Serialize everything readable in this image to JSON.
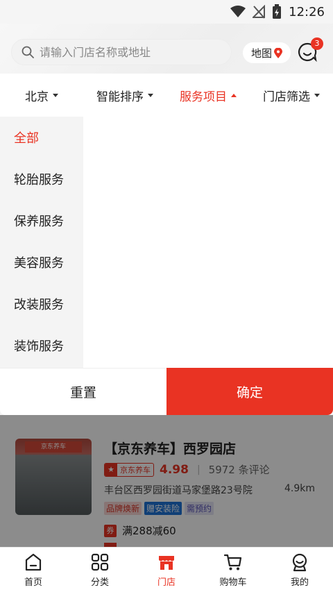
{
  "status_bar": {
    "time": "12:26"
  },
  "search": {
    "placeholder": "请输入门店名称或地址"
  },
  "header": {
    "map_label": "地图",
    "msg_badge": "3"
  },
  "filters": [
    {
      "label": "北京",
      "active": false
    },
    {
      "label": "智能排序",
      "active": false
    },
    {
      "label": "服务项目",
      "active": true
    },
    {
      "label": "门店筛选",
      "active": false
    }
  ],
  "categories": [
    "全部",
    "轮胎服务",
    "保养服务",
    "美容服务",
    "改装服务",
    "装饰服务"
  ],
  "dropdown": {
    "reset_label": "重置",
    "confirm_label": "确定"
  },
  "store": {
    "name": "【京东养车】西罗园店",
    "brand": "京东养车",
    "rating": "4.98",
    "divider": "|",
    "reviews": "5972 条评论",
    "address": "丰台区西罗园街道马家堡路23号院",
    "distance": "4.9km",
    "tags": [
      "品牌焕新",
      "赠安装险",
      "需预约"
    ],
    "coupon_icon": "券",
    "coupon": "满288减60",
    "image_sign": "京东养车"
  },
  "nav": [
    {
      "label": "首页",
      "icon": "home-icon"
    },
    {
      "label": "分类",
      "icon": "category-icon"
    },
    {
      "label": "门店",
      "icon": "store-icon"
    },
    {
      "label": "购物车",
      "icon": "cart-icon"
    },
    {
      "label": "我的",
      "icon": "profile-icon"
    }
  ],
  "colors": {
    "accent": "#e93323",
    "tag_blue": "#1e73d8"
  }
}
